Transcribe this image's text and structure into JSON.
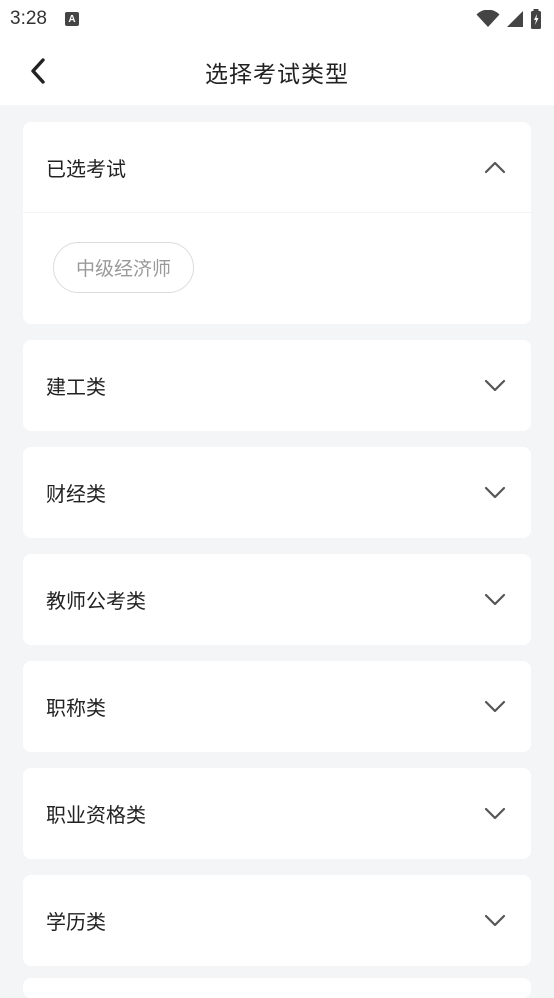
{
  "status_bar": {
    "time": "3:28",
    "notification_letter": "A",
    "icons": [
      "wifi-icon",
      "signal-icon",
      "battery-icon"
    ]
  },
  "app_bar": {
    "title": "选择考试类型",
    "back_icon": "chevron-left-icon"
  },
  "selected_section": {
    "title": "已选考试",
    "expanded": true,
    "chips": [
      "中级经济师"
    ]
  },
  "categories": [
    {
      "label": "建工类",
      "expanded": false
    },
    {
      "label": "财经类",
      "expanded": false
    },
    {
      "label": "教师公考类",
      "expanded": false
    },
    {
      "label": "职称类",
      "expanded": false
    },
    {
      "label": "职业资格类",
      "expanded": false
    },
    {
      "label": "学历类",
      "expanded": false
    }
  ],
  "colors": {
    "background": "#f4f5f7",
    "card": "#ffffff",
    "text": "#222222",
    "chip_text": "#9a9a9a",
    "chevron": "#555555"
  }
}
